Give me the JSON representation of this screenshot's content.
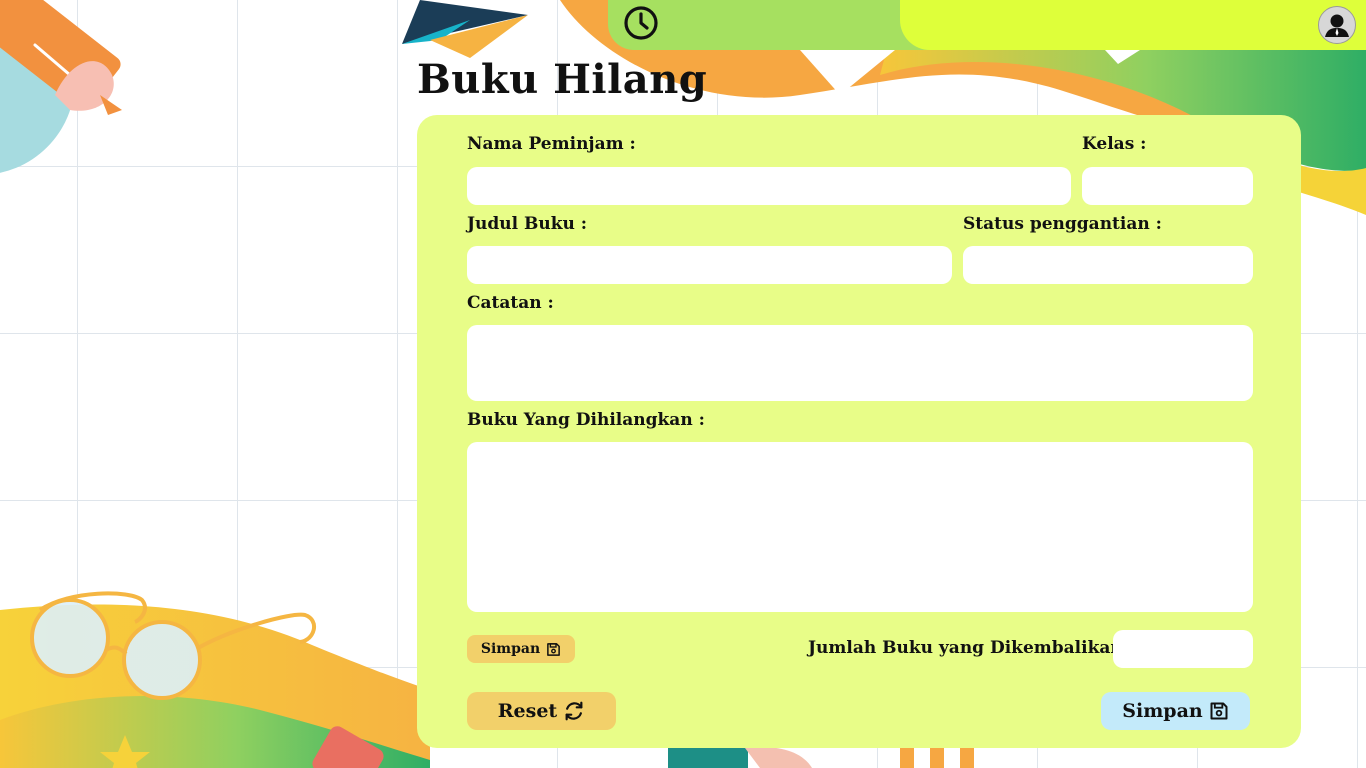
{
  "page": {
    "title": "Buku Hilang"
  },
  "topbar": {
    "history_icon": "clock-icon",
    "profile_icon": "user-icon",
    "colors": {
      "green": "#a6e060",
      "lime": "#deff3a"
    }
  },
  "form": {
    "panel_color": "#e8fd88",
    "nama_peminjam": {
      "label": "Nama Peminjam :",
      "value": ""
    },
    "kelas": {
      "label": "Kelas :",
      "value": ""
    },
    "judul_buku": {
      "label": "Judul Buku :",
      "value": ""
    },
    "status_penggantian": {
      "label": "Status penggantian :",
      "value": ""
    },
    "catatan": {
      "label": "Catatan :",
      "value": ""
    },
    "buku_dihilangkan": {
      "label": "Buku Yang Dihilangkan :",
      "value": ""
    },
    "jumlah_buku": {
      "label": "Jumlah Buku yang Dikembalikan :",
      "value": ""
    },
    "small_save_label": "Simpan"
  },
  "actions": {
    "reset_label": "Reset",
    "reset_icon": "refresh-icon",
    "save_label": "Simpan",
    "save_icon": "floppy-disk-icon",
    "reset_color": "#f2d06a",
    "save_color": "#c3eafa"
  }
}
